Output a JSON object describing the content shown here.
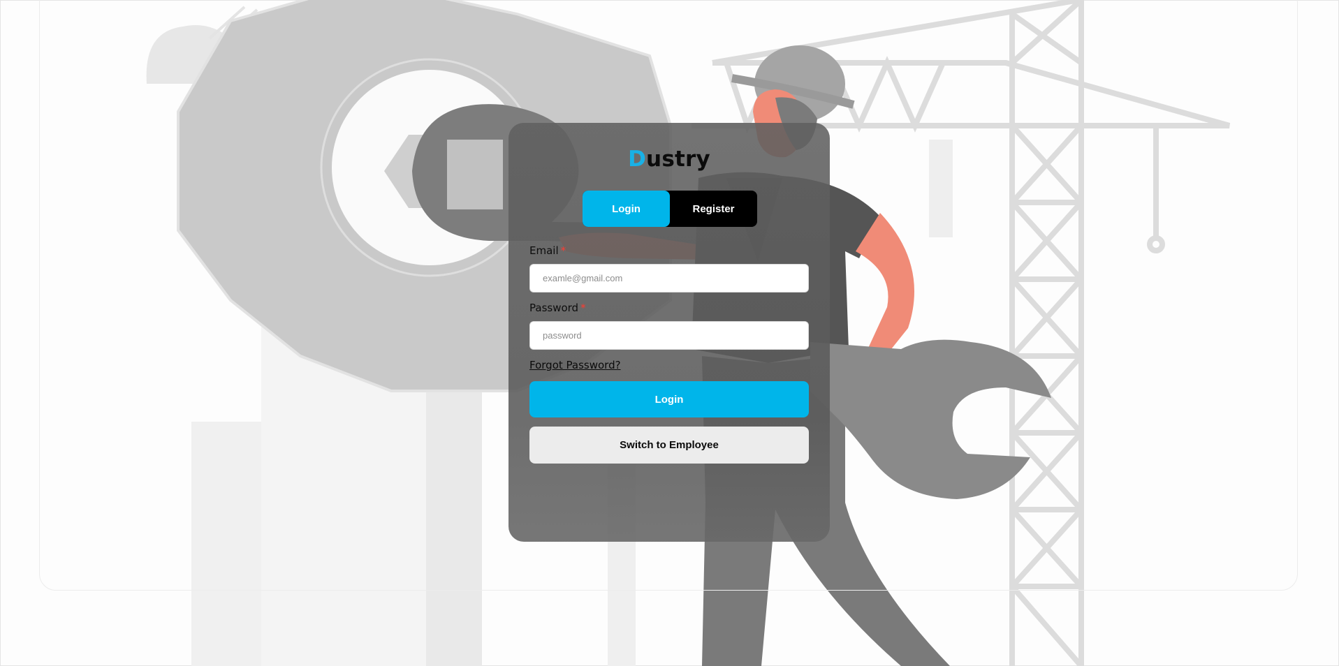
{
  "brand": {
    "accent_letter": "D",
    "rest": "ustry",
    "accent_color": "#19b1e6"
  },
  "mode_toggle": {
    "login_label": "Login",
    "register_label": "Register",
    "active": "Login"
  },
  "form": {
    "email_label": "Email",
    "email_required_mark": "*",
    "email_placeholder": "examle@gmail.com",
    "email_value": "",
    "password_label": "Password",
    "password_required_mark": "*",
    "password_placeholder": "password",
    "password_value": "",
    "forgot_label": "Forgot Password?",
    "submit_label": "Login",
    "switch_label": "Switch to Employee"
  },
  "colors": {
    "primary": "#00b5ea",
    "toggle_background": "#000000",
    "required": "#ff3b30",
    "secondary_button": "#ececec"
  },
  "icons": {
    "background_illustration": "construction-worker-with-wrench-gear-crane-illustration"
  }
}
